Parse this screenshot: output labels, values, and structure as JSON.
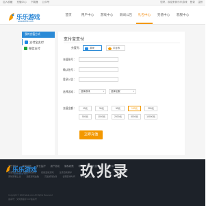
{
  "topbar": {
    "left": [
      "加入收藏",
      "充值中心",
      "下载器",
      "公众号"
    ],
    "right": [
      "您好，欢迎来到乐乐游戏",
      "登录",
      "注册"
    ]
  },
  "logo": {
    "text": "乐乐游戏",
    "url": "www.lelele.com"
  },
  "nav": {
    "items": [
      "首页",
      "用户中心",
      "游戏中心",
      "新闻公告",
      "礼包中心",
      "充值中心",
      "客服中心"
    ],
    "active_index": 5
  },
  "sidebar": {
    "title": "我的充值方式",
    "items": [
      {
        "label": "支付宝支付",
        "active": true,
        "icon_color": "#1e88e5"
      },
      {
        "label": "微信支付",
        "active": false,
        "icon_color": "#1ea43a"
      }
    ]
  },
  "content": {
    "title": "支付宝支付",
    "pay_label": "充值到：",
    "pay_options": [
      {
        "label": "游戏",
        "selected": true,
        "icon_color": "#1e88e5"
      },
      {
        "label": "平台币",
        "selected": false,
        "icon_color": "#f39800"
      }
    ],
    "account_label": "充值账号：",
    "confirm_label": "确认账号：",
    "server_label": "登录公告：",
    "game_label": "选择游戏：",
    "game_select": "选择游戏",
    "server_select": "选择区服",
    "amount_label": "充值金额：",
    "amounts": [
      "10元",
      "30元",
      "50元",
      "100元",
      "200元",
      "500元",
      "1000元",
      "2000元",
      "5000元",
      "10000元"
    ],
    "amount_selected_index": 3,
    "submit_label": "立即充值"
  },
  "footer": {
    "links": [
      "关于我们",
      "商务合作",
      "家长监护",
      "用户协议",
      "隐私政策",
      "联系我们",
      "充值中心",
      "客服中心"
    ],
    "rows": [
      [
        "健康游戏公告：抵制不良游戏",
        "拒绝盗版游戏",
        "注意自我保护"
      ],
      [
        "谨防受骗上当",
        "适度游戏益脑",
        "沉迷游戏伤身",
        "合理安排时间",
        "享受健康生活"
      ]
    ],
    "logo_text": "乐乐游戏",
    "logo_url": "www.lelele.com",
    "small": [
      "Copyright © 2020 lelele.com All Rights Reserved",
      "备案号：文网游备字 ICP备案号"
    ],
    "watermark": "玖兆录"
  }
}
